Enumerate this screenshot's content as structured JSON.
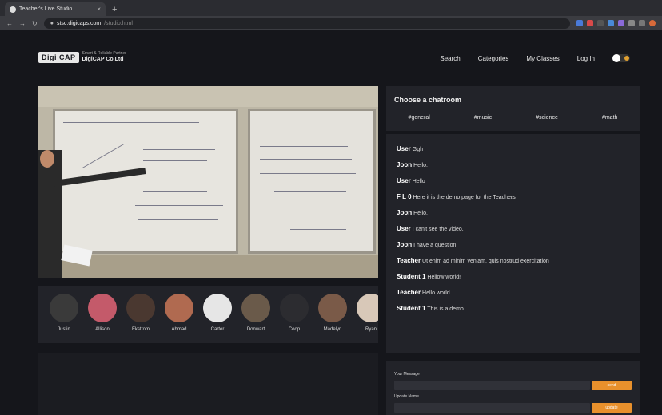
{
  "browser": {
    "tab_title": "Teacher's Live Studio",
    "tab_close": "×",
    "new_tab": "+",
    "url_host": "stsc.digicaps.com",
    "url_path": "/studio.html"
  },
  "nav": {
    "logo_mark": "Digi CAP",
    "logo_tagline": "Smart & Reliable Partner",
    "logo_company": "DigiCAP Co.Ltd",
    "items": [
      "Search",
      "Categories",
      "My Classes",
      "Log In"
    ]
  },
  "participants": [
    {
      "name": "Justin",
      "color": "#3a3a3a"
    },
    {
      "name": "Allison",
      "color": "#c45a6a"
    },
    {
      "name": "Ekstrom",
      "color": "#4a3830"
    },
    {
      "name": "Ahmad",
      "color": "#b06a50"
    },
    {
      "name": "Carter",
      "color": "#e6e6e6"
    },
    {
      "name": "Donwart",
      "color": "#6a5a4a"
    },
    {
      "name": "Coop",
      "color": "#2c2c30"
    },
    {
      "name": "Madelyn",
      "color": "#7a5a48"
    },
    {
      "name": "Ryan",
      "color": "#d8c8b8"
    }
  ],
  "chat": {
    "heading": "Choose a chatroom",
    "rooms": [
      "#general",
      "#music",
      "#science",
      "#math"
    ],
    "messages": [
      {
        "user": "User",
        "text": "Ggh"
      },
      {
        "user": "Joon",
        "text": "Hello."
      },
      {
        "user": "User",
        "text": "Hello"
      },
      {
        "user": "F L 0",
        "text": "Here it is the demo page for the Teachers"
      },
      {
        "user": "Joon",
        "text": "Hello."
      },
      {
        "user": "User",
        "text": "I can't see the video."
      },
      {
        "user": "Joon",
        "text": "I have a question."
      },
      {
        "user": "Teacher",
        "text": "Ut enim ad minim veniam, quis nostrud exercitation"
      },
      {
        "user": "Student 1",
        "text": "Hellow world!"
      },
      {
        "user": "Teacher",
        "text": "Hello world."
      },
      {
        "user": "Student 1",
        "text": "This is a demo."
      }
    ]
  },
  "send_form": {
    "message_label": "Your Message",
    "send_button": "send",
    "name_label": "Update Name",
    "update_button": "update"
  }
}
